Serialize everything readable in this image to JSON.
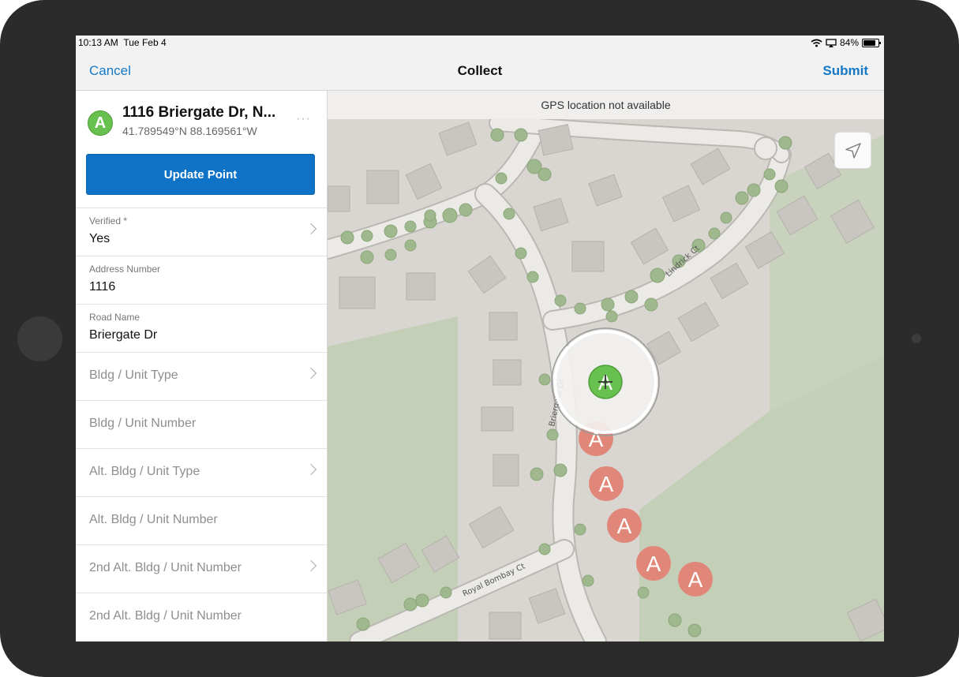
{
  "status": {
    "time": "10:13 AM",
    "date": "Tue Feb 4",
    "battery_percent": "84%",
    "battery_level": 0.84
  },
  "nav": {
    "cancel": "Cancel",
    "title": "Collect",
    "submit": "Submit"
  },
  "feature": {
    "symbol": "A",
    "title": "1116 Briergate Dr, N...",
    "coords": "41.789549°N  88.169561°W",
    "more": "···"
  },
  "update_button": "Update Point",
  "fields": [
    {
      "label": "Verified *",
      "value": "Yes",
      "chevron": true
    },
    {
      "label": "Address Number",
      "value": "1116",
      "chevron": false
    },
    {
      "label": "Road Name",
      "value": "Briergate Dr",
      "chevron": false
    },
    {
      "placeholder": "Bldg / Unit Type",
      "chevron": true
    },
    {
      "placeholder": "Bldg / Unit Number",
      "chevron": false
    },
    {
      "placeholder": "Alt. Bldg / Unit Type",
      "chevron": true
    },
    {
      "placeholder": "Alt. Bldg / Unit Number",
      "chevron": false
    },
    {
      "placeholder": "2nd Alt. Bldg / Unit Number",
      "chevron": true
    },
    {
      "placeholder": "2nd Alt. Bldg / Unit Number",
      "chevron": false
    }
  ],
  "map": {
    "gps_banner": "GPS location not available",
    "street_labels": {
      "lindrick": "Lindrick Ct",
      "briergate": "Briergate Dr",
      "royal_bombay": "Royal Bombay Ct"
    },
    "marker_letter": "A",
    "colors": {
      "selected_marker": "#68c04f",
      "existing_marker": "#e0877a",
      "accent": "#1479c7"
    }
  },
  "icons": {
    "location": "location-arrow-icon",
    "wifi": "wifi-icon",
    "airplay": "screen-mirroring-icon",
    "battery": "battery-icon",
    "chevron": "chevron-right-icon"
  }
}
